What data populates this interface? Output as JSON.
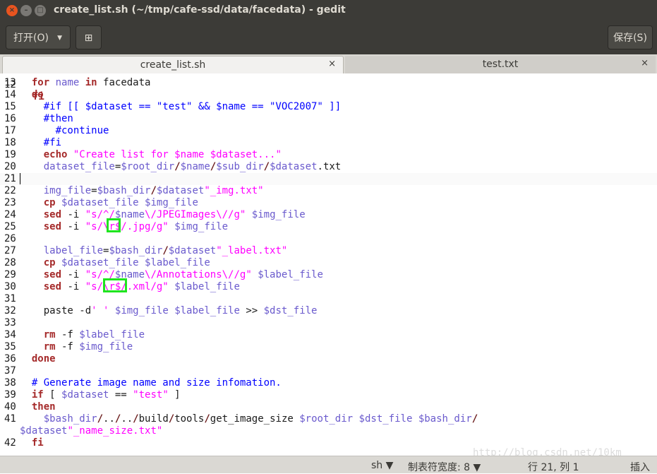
{
  "window": {
    "title": "create_list.sh (~/tmp/cafe-ssd/data/facedata) - gedit",
    "close_glyph": "×",
    "min_glyph": "–",
    "max_glyph": "□"
  },
  "toolbar": {
    "open_label": "打开(O)",
    "open_arrow": "▼",
    "new_glyph": "⊞",
    "save_label": "保存(S)"
  },
  "tabs": [
    {
      "label": "create_list.sh",
      "close": "×",
      "active": true
    },
    {
      "label": "test.txt",
      "close": "×",
      "active": false
    }
  ],
  "editor": {
    "partial_top": {
      "num": "12",
      "text": "fi"
    },
    "lines": [
      {
        "num": "13"
      },
      {
        "num": "14"
      },
      {
        "num": "15"
      },
      {
        "num": "16"
      },
      {
        "num": "17"
      },
      {
        "num": "18"
      },
      {
        "num": "19"
      },
      {
        "num": "20"
      },
      {
        "num": "21"
      },
      {
        "num": "22"
      },
      {
        "num": "23"
      },
      {
        "num": "24"
      },
      {
        "num": "25"
      },
      {
        "num": "26"
      },
      {
        "num": "27"
      },
      {
        "num": "28"
      },
      {
        "num": "29"
      },
      {
        "num": "30"
      },
      {
        "num": "31"
      },
      {
        "num": "32"
      },
      {
        "num": "33"
      },
      {
        "num": "34"
      },
      {
        "num": "35"
      },
      {
        "num": "36"
      },
      {
        "num": "37"
      },
      {
        "num": "38"
      },
      {
        "num": "39"
      },
      {
        "num": "40"
      },
      {
        "num": "41"
      },
      {
        "num": "42"
      }
    ]
  },
  "statusbar": {
    "language": "sh ▼",
    "tab_width": "制表符宽度: 8 ▼",
    "position": "行 21, 列 1",
    "mode": "插入"
  },
  "watermark": "http://blog.csdn.net/10km",
  "colors": {
    "keyword": "#a52a2a",
    "variable": "#6a5acd",
    "string": "#ff00ff",
    "comment": "#0000ff",
    "highlight_box": "#1fe51f"
  }
}
